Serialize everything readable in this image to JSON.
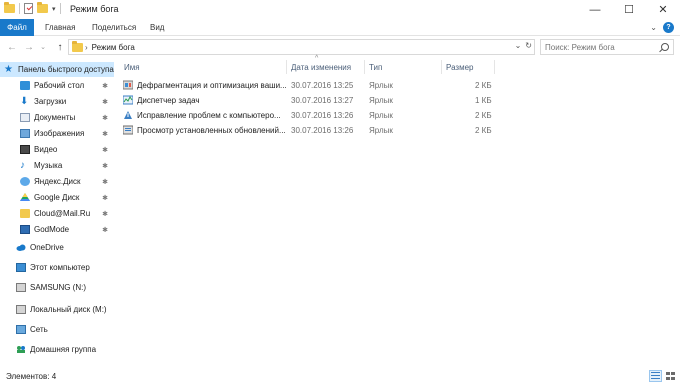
{
  "window": {
    "title": "Режим бога",
    "controls": {
      "minimize": "—",
      "maximize": "☐",
      "close": "✕"
    }
  },
  "ribbon": {
    "tabs": [
      {
        "label": "Файл",
        "active": true
      },
      {
        "label": "Главная"
      },
      {
        "label": "Поделиться"
      },
      {
        "label": "Вид"
      }
    ],
    "expand": "⌄",
    "help": "?"
  },
  "navigation": {
    "back": "←",
    "forward": "→",
    "recent": "⌄",
    "up": "↑",
    "breadcrumb": "Режим бога",
    "search_placeholder": "Поиск: Режим бога"
  },
  "sidebar": {
    "items": [
      {
        "label": "Панель быстрого доступа",
        "icon": "star-icon",
        "active": true
      },
      {
        "label": "Рабочий стол",
        "icon": "desktop-icon",
        "pinned": true
      },
      {
        "label": "Загрузки",
        "icon": "download-icon",
        "pinned": true
      },
      {
        "label": "Документы",
        "icon": "documents-icon",
        "pinned": true
      },
      {
        "label": "Изображения",
        "icon": "images-icon",
        "pinned": true
      },
      {
        "label": "Видео",
        "icon": "video-icon",
        "pinned": true
      },
      {
        "label": "Музыка",
        "icon": "music-icon",
        "pinned": true
      },
      {
        "label": "Яндекс.Диск",
        "icon": "yandex-disk-icon",
        "pinned": true
      },
      {
        "label": "Google Диск",
        "icon": "google-drive-icon",
        "pinned": true
      },
      {
        "label": "Cloud@Mail.Ru",
        "icon": "folder-icon",
        "pinned": true
      },
      {
        "label": "GodMode",
        "icon": "godmode-icon",
        "pinned": true
      },
      {
        "label": "OneDrive",
        "icon": "onedrive-icon"
      },
      {
        "label": "Этот компьютер",
        "icon": "computer-icon"
      },
      {
        "label": "SAMSUNG (N:)",
        "icon": "drive-icon"
      },
      {
        "label": "Локальный диск (M:)",
        "icon": "drive-icon"
      },
      {
        "label": "Сеть",
        "icon": "network-icon"
      },
      {
        "label": "Домашняя группа",
        "icon": "homegroup-icon"
      }
    ]
  },
  "table": {
    "columns": [
      "Имя",
      "Дата изменения",
      "Тип",
      "Размер"
    ],
    "sort_indicator": "^",
    "rows": [
      {
        "name": "Дефрагментация и оптимизация ваши...",
        "date": "30.07.2016 13:25",
        "type": "Ярлык",
        "size": "2 КБ",
        "icon": "defrag-icon"
      },
      {
        "name": "Диспетчер задач",
        "date": "30.07.2016 13:27",
        "type": "Ярлык",
        "size": "1 КБ",
        "icon": "task-manager-icon"
      },
      {
        "name": "Исправление проблем с компьютеро...",
        "date": "30.07.2016 13:26",
        "type": "Ярлык",
        "size": "2 КБ",
        "icon": "troubleshoot-icon"
      },
      {
        "name": "Просмотр установленных обновлений...",
        "date": "30.07.2016 13:26",
        "type": "Ярлык",
        "size": "2 КБ",
        "icon": "updates-icon"
      }
    ]
  },
  "status": {
    "items_count": "Элементов: 4"
  },
  "colors": {
    "accent": "#1979ca",
    "selection": "#cce8ff",
    "folder": "#f2c94c"
  }
}
